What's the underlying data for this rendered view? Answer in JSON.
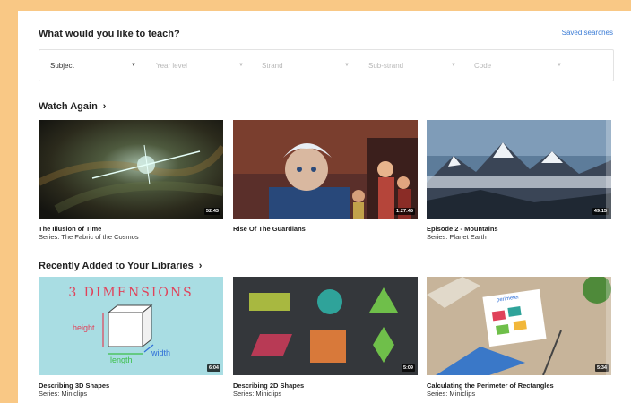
{
  "header": {
    "title": "What would you like to teach?",
    "saved_searches": "Saved searches"
  },
  "filters": [
    {
      "label": "Subject",
      "active": true
    },
    {
      "label": "Year level",
      "active": false
    },
    {
      "label": "Strand",
      "active": false
    },
    {
      "label": "Sub-strand",
      "active": false
    },
    {
      "label": "Code",
      "active": false
    }
  ],
  "watch_again": {
    "title": "Watch Again",
    "items": [
      {
        "title": "The Illusion of Time",
        "series": "Series: The Fabric of the Cosmos",
        "duration": "52:43"
      },
      {
        "title": "Rise Of The Guardians",
        "series": "",
        "duration": "1:27:45"
      },
      {
        "title": "Episode 2 - Mountains",
        "series": "Series: Planet Earth",
        "duration": "49:15"
      }
    ]
  },
  "recent": {
    "title": "Recently Added to Your Libraries",
    "items": [
      {
        "title": "Describing 3D Shapes",
        "series": "Series: Miniclips",
        "duration": "6:04",
        "thumb_text": {
          "heading": "3 DIMENSIONS",
          "height": "height",
          "length": "length",
          "width": "width"
        }
      },
      {
        "title": "Describing 2D Shapes",
        "series": "Series: Miniclips",
        "duration": "5:09"
      },
      {
        "title": "Calculating the Perimeter of Rectangles",
        "series": "Series: Miniclips",
        "duration": "5:34",
        "thumb_text": {
          "card": "perimeter"
        }
      }
    ]
  }
}
